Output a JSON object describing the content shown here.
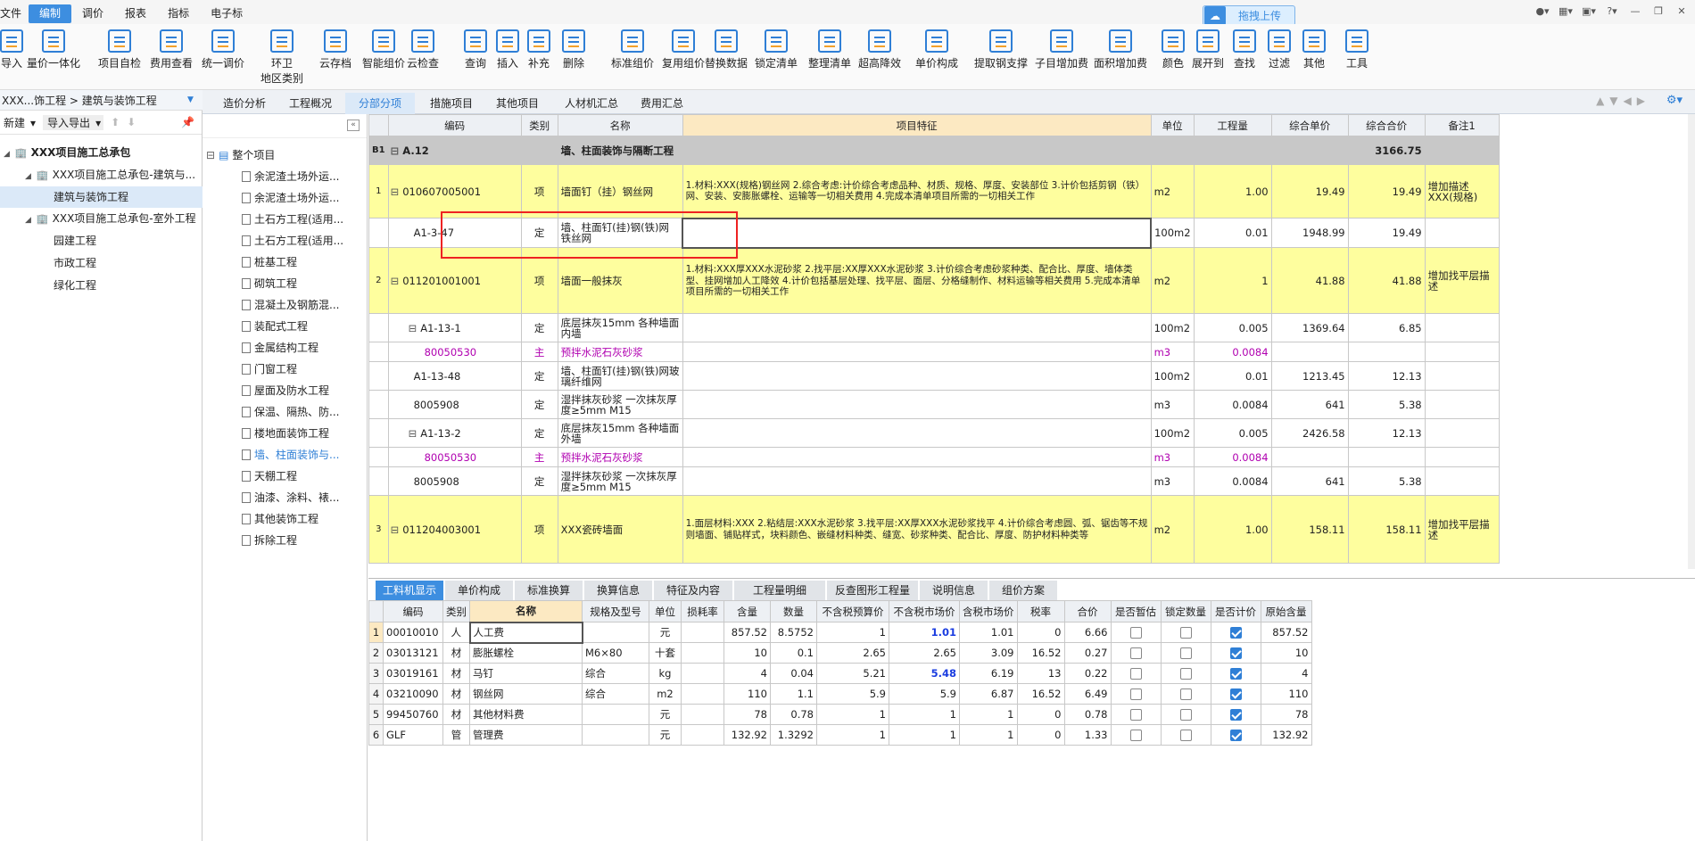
{
  "menu": [
    "文件",
    "编制",
    "调价",
    "报表",
    "指标",
    "电子标"
  ],
  "cloud_upload": "拖拽上传",
  "toolbar": [
    "导入",
    "量价一体化",
    "项目自检",
    "费用查看",
    "统一调价",
    "环卫地区类别",
    "云存档",
    "智能组价",
    "云检查",
    "查询",
    "插入",
    "补充",
    "删除",
    "标准组价",
    "复用组价",
    "替换数据",
    "锁定清单",
    "整理清单",
    "超高降效",
    "单价构成",
    "提取钢支撑",
    "子目增加费",
    "面积增加费",
    "颜色",
    "展开到",
    "查找",
    "过滤",
    "其他",
    "工具"
  ],
  "breadcrumb": "XXX...饰工程 > 建筑与装饰工程",
  "top_tabs": [
    "造价分析",
    "工程概况",
    "分部分项",
    "措施项目",
    "其他项目",
    "人材机汇总",
    "费用汇总"
  ],
  "left_actions": {
    "new": "新建",
    "import_export": "导入导出"
  },
  "project_tree": [
    {
      "label": "XXX项目施工总承包",
      "level": 0
    },
    {
      "label": "XXX项目施工总承包-建筑与...",
      "level": 1
    },
    {
      "label": "建筑与装饰工程",
      "level": 2,
      "selected": true
    },
    {
      "label": "XXX项目施工总承包-室外工程",
      "level": 1
    },
    {
      "label": "园建工程",
      "level": 2
    },
    {
      "label": "市政工程",
      "level": 2
    },
    {
      "label": "绿化工程",
      "level": 2
    }
  ],
  "section_tree_root": "整个项目",
  "section_tree": [
    "余泥渣土场外运...",
    "余泥渣土场外运...",
    "土石方工程(适用...",
    "土石方工程(适用...",
    "桩基工程",
    "砌筑工程",
    "混凝土及钢筋混...",
    "装配式工程",
    "金属结构工程",
    "门窗工程",
    "屋面及防水工程",
    "保温、隔热、防...",
    "楼地面装饰工程",
    "墙、柱面装饰与...",
    "天棚工程",
    "油漆、涂料、裱...",
    "其他装饰工程",
    "拆除工程"
  ],
  "main_headers": [
    "编码",
    "类别",
    "名称",
    "项目特征",
    "单位",
    "工程量",
    "综合单价",
    "综合合价",
    "备注1"
  ],
  "main_rows": [
    {
      "idx": "B1",
      "code": "A.12",
      "type": "",
      "name": "墙、柱面装饰与隔断工程",
      "feature": "",
      "unit": "",
      "qty": "",
      "price": "",
      "total": "3166.75",
      "note": "",
      "style": "gray",
      "h": 32
    },
    {
      "idx": "1",
      "code": "010607005001",
      "type": "项",
      "name": "墙面钉（挂）钢丝网",
      "feature": "1.材料:XXX(规格)钢丝网\n2.综合考虑:计价综合考虑品种、材质、规格、厚度、安装部位\n3.计价包括剪钢（铁）网、安装、安膨胀螺栓、运输等一切相关费用\n4.完成本清单项目所需的一切相关工作",
      "unit": "m2",
      "qty": "1.00",
      "price": "19.49",
      "total": "19.49",
      "note": "增加描述XXX(规格)",
      "style": "yellow",
      "h": 60
    },
    {
      "idx": "",
      "code": "A1-3-47",
      "type": "定",
      "name": "墙、柱面钉(挂)钢(铁)网铁丝网",
      "feature": "",
      "unit": "100m2",
      "qty": "0.01",
      "price": "1948.99",
      "total": "19.49",
      "note": "",
      "style": "",
      "h": 33
    },
    {
      "idx": "2",
      "code": "011201001001",
      "type": "项",
      "name": "墙面一般抹灰",
      "feature": "1.材料:XXX厚XXX水泥砂浆\n2.找平层:XX厚XXX水泥砂浆\n3.计价综合考虑砂浆种类、配合比、厚度、墙体类型、挂网增加人工降效\n4.计价包括基层处理、找平层、面层、分格缝制作、材料运输等相关费用\n5.完成本清单项目所需的一切相关工作",
      "unit": "m2",
      "qty": "1",
      "price": "41.88",
      "total": "41.88",
      "note": "增加找平层描述",
      "style": "yellow",
      "h": 74
    },
    {
      "idx": "",
      "code": "A1-13-1",
      "type": "定",
      "name": "底层抹灰15mm 各种墙面内墙",
      "feature": "",
      "unit": "100m2",
      "qty": "0.005",
      "price": "1369.64",
      "total": "6.85",
      "note": "",
      "style": "",
      "h": 32
    },
    {
      "idx": "",
      "code": "80050530",
      "type": "主",
      "name": "预拌水泥石灰砂浆",
      "feature": "",
      "unit": "m3",
      "qty": "0.0084",
      "price": "",
      "total": "",
      "note": "",
      "style": "mag",
      "h": 22
    },
    {
      "idx": "",
      "code": "A1-13-48",
      "type": "定",
      "name": "墙、柱面钉(挂)钢(铁)网玻璃纤维网",
      "feature": "",
      "unit": "100m2",
      "qty": "0.01",
      "price": "1213.45",
      "total": "12.13",
      "note": "",
      "style": "",
      "h": 32
    },
    {
      "idx": "",
      "code": "8005908",
      "type": "定",
      "name": "湿拌抹灰砂浆 一次抹灰厚度≥5mm M15",
      "feature": "",
      "unit": "m3",
      "qty": "0.0084",
      "price": "641",
      "total": "5.38",
      "note": "",
      "style": "",
      "h": 32
    },
    {
      "idx": "",
      "code": "A1-13-2",
      "type": "定",
      "name": "底层抹灰15mm 各种墙面外墙",
      "feature": "",
      "unit": "100m2",
      "qty": "0.005",
      "price": "2426.58",
      "total": "12.13",
      "note": "",
      "style": "",
      "h": 32
    },
    {
      "idx": "",
      "code": "80050530",
      "type": "主",
      "name": "预拌水泥石灰砂浆",
      "feature": "",
      "unit": "m3",
      "qty": "0.0084",
      "price": "",
      "total": "",
      "note": "",
      "style": "mag",
      "h": 22
    },
    {
      "idx": "",
      "code": "8005908",
      "type": "定",
      "name": "湿拌抹灰砂浆 一次抹灰厚度≥5mm M15",
      "feature": "",
      "unit": "m3",
      "qty": "0.0084",
      "price": "641",
      "total": "5.38",
      "note": "",
      "style": "",
      "h": 32
    },
    {
      "idx": "3",
      "code": "011204003001",
      "type": "项",
      "name": "XXX瓷砖墙面",
      "feature": "1.面层材料:XXX\n2.粘结层:XXX水泥砂浆\n3.找平层:XX厚XXX水泥砂浆找平\n4.计价综合考虑圆、弧、锯齿等不规则墙面、铺贴样式，块料颜色、嵌缝材料种类、缝宽、砂浆种类、配合比、厚度、防护材料种类等",
      "unit": "m2",
      "qty": "1.00",
      "price": "158.11",
      "total": "158.11",
      "note": "增加找平层描述",
      "style": "yellow",
      "h": 76
    }
  ],
  "bottom_tabs": [
    "工料机显示",
    "单价构成",
    "标准换算",
    "换算信息",
    "特征及内容",
    "工程量明细",
    "反查图形工程量",
    "说明信息",
    "组价方案"
  ],
  "bottom_headers": [
    "编码",
    "类别",
    "名称",
    "规格及型号",
    "单位",
    "损耗率",
    "含量",
    "数量",
    "不含税预算价",
    "不含税市场价",
    "含税市场价",
    "税率",
    "合价",
    "是否暂估",
    "锁定数量",
    "是否计价",
    "原始含量"
  ],
  "bottom_rows": [
    {
      "n": "1",
      "code": "00010010",
      "type": "人",
      "name": "人工费",
      "spec": "",
      "unit": "元",
      "loss": "",
      "content": "857.52",
      "qty": "8.5752",
      "budget": "1",
      "market": "1.01",
      "tax_market": "1.01",
      "tax": "0",
      "total": "6.66",
      "temp": false,
      "lock": false,
      "price": true,
      "orig": "857.52",
      "market_hl": true
    },
    {
      "n": "2",
      "code": "03013121",
      "type": "材",
      "name": "膨胀螺栓",
      "spec": "M6×80",
      "unit": "十套",
      "loss": "",
      "content": "10",
      "qty": "0.1",
      "budget": "2.65",
      "market": "2.65",
      "tax_market": "3.09",
      "tax": "16.52",
      "total": "0.27",
      "temp": false,
      "lock": false,
      "price": true,
      "orig": "10",
      "market_hl": false
    },
    {
      "n": "3",
      "code": "03019161",
      "type": "材",
      "name": "马钉",
      "spec": "综合",
      "unit": "kg",
      "loss": "",
      "content": "4",
      "qty": "0.04",
      "budget": "5.21",
      "market": "5.48",
      "tax_market": "6.19",
      "tax": "13",
      "total": "0.22",
      "temp": false,
      "lock": false,
      "price": true,
      "orig": "4",
      "market_hl": true
    },
    {
      "n": "4",
      "code": "03210090",
      "type": "材",
      "name": "钢丝网",
      "spec": "综合",
      "unit": "m2",
      "loss": "",
      "content": "110",
      "qty": "1.1",
      "budget": "5.9",
      "market": "5.9",
      "tax_market": "6.87",
      "tax": "16.52",
      "total": "6.49",
      "temp": false,
      "lock": false,
      "price": true,
      "orig": "110",
      "market_hl": false
    },
    {
      "n": "5",
      "code": "99450760",
      "type": "材",
      "name": "其他材料费",
      "spec": "",
      "unit": "元",
      "loss": "",
      "content": "78",
      "qty": "0.78",
      "budget": "1",
      "market": "1",
      "tax_market": "1",
      "tax": "0",
      "total": "0.78",
      "temp": false,
      "lock": false,
      "price": true,
      "orig": "78",
      "market_hl": false
    },
    {
      "n": "6",
      "code": "GLF",
      "type": "管",
      "name": "管理费",
      "spec": "",
      "unit": "元",
      "loss": "",
      "content": "132.92",
      "qty": "1.3292",
      "budget": "1",
      "market": "1",
      "tax_market": "1",
      "tax": "0",
      "total": "1.33",
      "temp": false,
      "lock": false,
      "price": true,
      "orig": "132.92",
      "market_hl": false
    }
  ],
  "colors": {
    "accent": "#3d8ee0",
    "yellow_row": "#fefe9e",
    "gray_row": "#c8c8c8",
    "magenta": "#b000b0",
    "highlight_box": "#e22222"
  }
}
